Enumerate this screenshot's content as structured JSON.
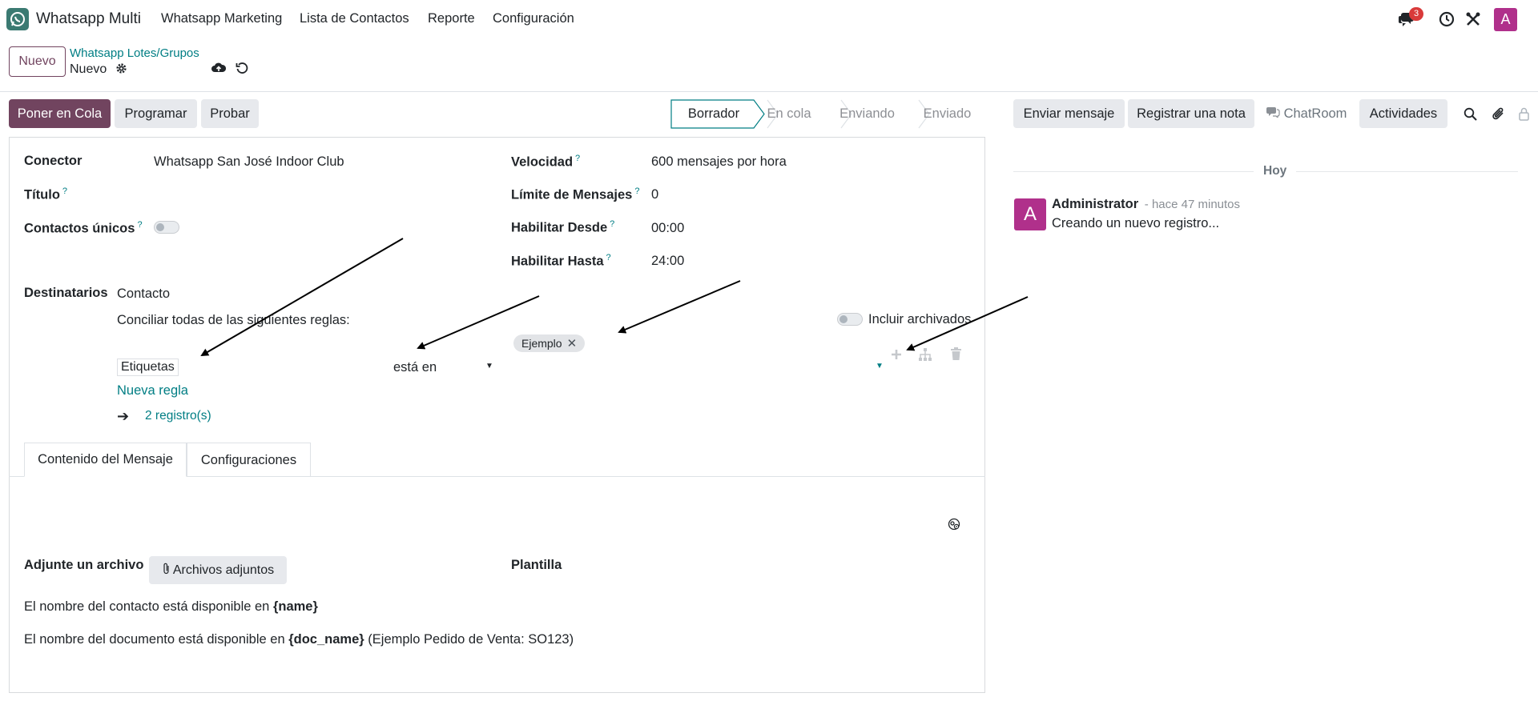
{
  "navbar": {
    "app_name": "Whatsapp Multi",
    "menu": [
      "Whatsapp Marketing",
      "Lista de Contactos",
      "Reporte",
      "Configuración"
    ],
    "messages_badge": "3",
    "user_initial": "A"
  },
  "control_panel": {
    "new_button": "Nuevo",
    "breadcrumb_parent": "Whatsapp Lotes/Grupos",
    "breadcrumb_current": "Nuevo"
  },
  "actions": {
    "enqueue": "Poner en Cola",
    "schedule": "Programar",
    "test": "Probar"
  },
  "status": {
    "stages": [
      "Borrador",
      "En cola",
      "Enviando",
      "Enviado"
    ],
    "current": "Borrador"
  },
  "form": {
    "connector_label": "Conector",
    "connector_value": "Whatsapp San José Indoor Club",
    "title_label": "Título",
    "unique_label": "Contactos únicos",
    "speed_label": "Velocidad",
    "speed_value": "600 mensajes por hora",
    "limit_label": "Límite de Mensajes",
    "limit_value": "0",
    "from_label": "Habilitar Desde",
    "from_value": "00:00",
    "to_label": "Habilitar Hasta",
    "to_value": "24:00",
    "recipients_label": "Destinatarios",
    "recipients_model": "Contacto",
    "rules_intro": "Conciliar todas de las siguientes reglas:",
    "include_archived": "Incluir archivados",
    "rule_field": "Etiquetas",
    "rule_operator": "está en",
    "rule_value_tag": "Ejemplo",
    "new_rule": "Nueva regla",
    "records": "2 registro(s)"
  },
  "tabs": [
    "Contenido del Mensaje",
    "Configuraciones"
  ],
  "content": {
    "attach_label": "Adjunte un archivo",
    "attach_button": "Archivos adjuntos",
    "template_label": "Plantilla",
    "hint1_prefix": "El nombre del contacto está disponible en ",
    "hint1_var": "{name}",
    "hint2_prefix": "El nombre del documento está disponible en ",
    "hint2_var": "{doc_name}",
    "hint2_suffix": " (Ejemplo Pedido de Venta: SO123)"
  },
  "chatter": {
    "send_message": "Enviar mensaje",
    "log_note": "Registrar una nota",
    "chatroom": "ChatRoom",
    "activities": "Actividades",
    "today": "Hoy",
    "author": "Administrator",
    "time": "- hace 47 minutos",
    "body": "Creando un nuevo registro...",
    "author_initial": "A"
  },
  "colors": {
    "primary": "#71445f",
    "link": "#017e84",
    "avatar": "#b0308b",
    "badge": "#d93a3a"
  }
}
